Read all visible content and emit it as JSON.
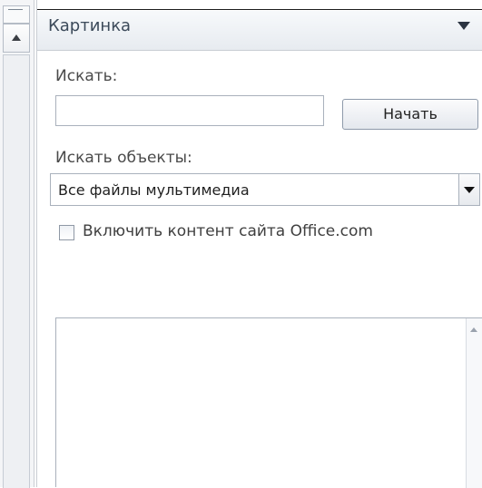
{
  "pane": {
    "title": "Картинка",
    "search_label": "Искать:",
    "search_value": "",
    "go_button": "Начать",
    "search_objects_label": "Искать объекты:",
    "media_type_selected": "Все файлы мультимедиа",
    "include_office_label": "Включить контент сайта Office.com",
    "include_office_checked": false
  },
  "icons": {
    "pane_menu": "dropdown-arrow-icon",
    "scroll_up": "scroll-up-arrow-icon",
    "combo_dropdown": "chevron-down-icon"
  }
}
